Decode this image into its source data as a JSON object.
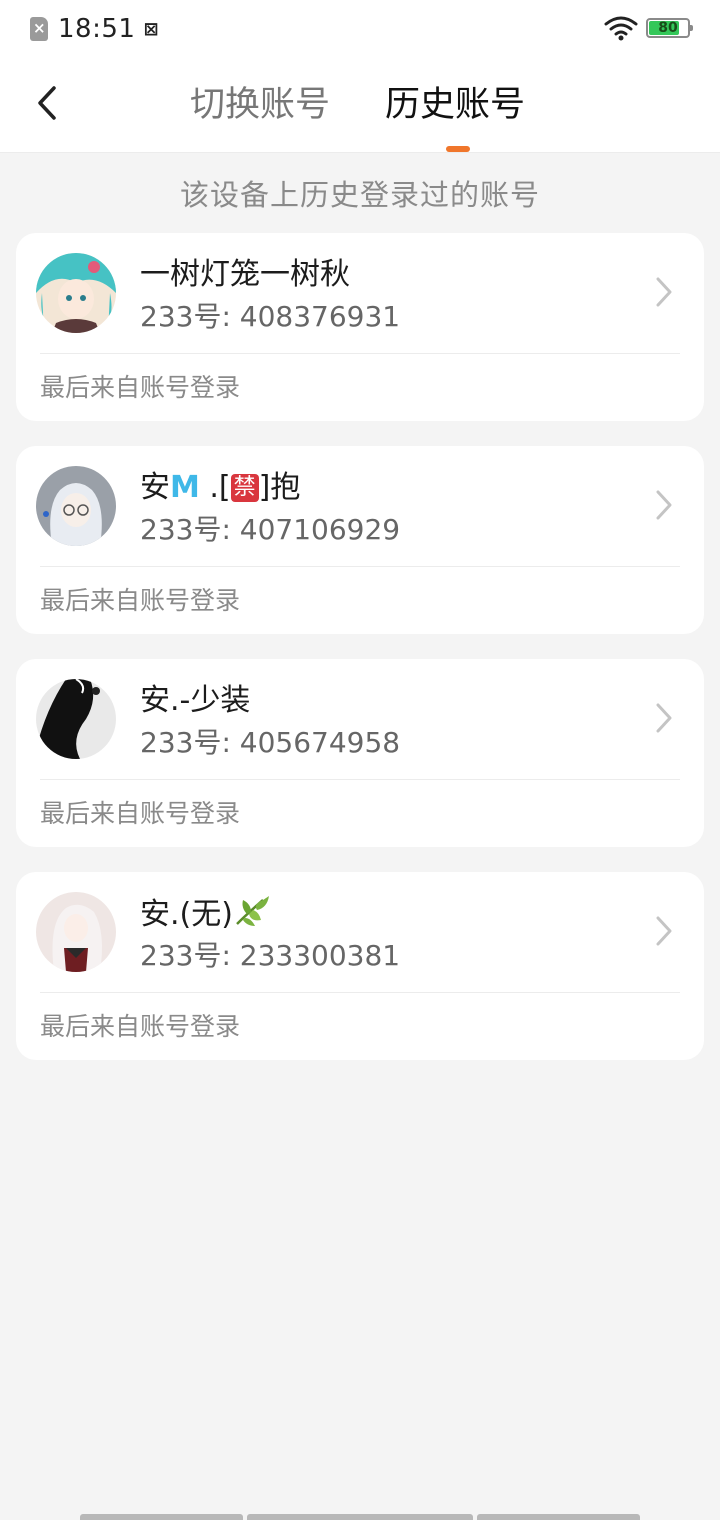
{
  "status_bar": {
    "time": "18:51",
    "battery_level": "80",
    "battery_fraction": 0.8
  },
  "header": {
    "tabs": [
      {
        "label": "切换账号",
        "active": false
      },
      {
        "label": "历史账号",
        "active": true
      }
    ]
  },
  "subtitle": "该设备上历史登录过的账号",
  "accounts": [
    {
      "name": "一树灯笼一树秋",
      "uid": "233号: 408376931",
      "login_source": "最后来自账号登录"
    },
    {
      "name_prefix": "安",
      "name_emoji_m": "M",
      "name_mid": " .[",
      "name_emoji_box": "禁",
      "name_suffix": "]抱",
      "uid": "233号: 407106929",
      "login_source": "最后来自账号登录"
    },
    {
      "name": "安.-少装",
      "uid": "233号: 405674958",
      "login_source": "最后来自账号登录"
    },
    {
      "name": "安.(无)",
      "uid": "233号: 233300381",
      "login_source": "最后来自账号登录"
    }
  ],
  "colors": {
    "accent": "#f0762b",
    "background": "#f4f4f4",
    "card": "#ffffff"
  }
}
